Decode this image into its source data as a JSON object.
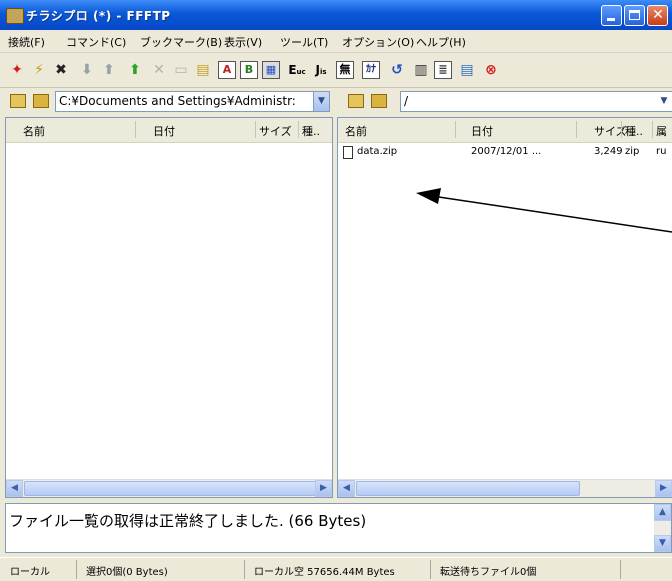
{
  "window": {
    "title": "チラシプロ (*) - FFFTP"
  },
  "menu": [
    "接続(F)",
    "コマンド(C)",
    "ブックマーク(B)",
    "表示(V)",
    "ツール(T)",
    "オプション(O)",
    "ヘルプ(H)"
  ],
  "toolbar": {
    "e_label": "E",
    "e_sub": "uc",
    "j_label": "J",
    "j_sub": "is",
    "mu_label": "無",
    "kana_label": "ｶﾅ"
  },
  "local": {
    "path": "C:¥Documents and Settings¥Administr:",
    "columns": {
      "name": "名前",
      "date": "日付",
      "size": "サイズ",
      "type": "種.."
    },
    "files": []
  },
  "remote": {
    "path": "/",
    "columns": {
      "name": "名前",
      "date": "日付",
      "size": "サイズ",
      "type": "種..",
      "extra": "属"
    },
    "files": [
      {
        "name": "data.zip",
        "date": "2007/12/01 ...",
        "size": "3,249",
        "type": "zip",
        "attr": "ru"
      }
    ]
  },
  "log": {
    "message": "ファイル一覧の取得は正常終了しました. (66 Bytes)"
  },
  "status": {
    "local": "ローカル",
    "selected": "選択0個(0 Bytes)",
    "free": "ローカル空 57656.44M Bytes",
    "queue": "転送待ちファイル0個"
  },
  "colors": {
    "titlebar": "#0a58d8",
    "panel": "#ece9d8",
    "annotation_arrow": "#000000"
  }
}
